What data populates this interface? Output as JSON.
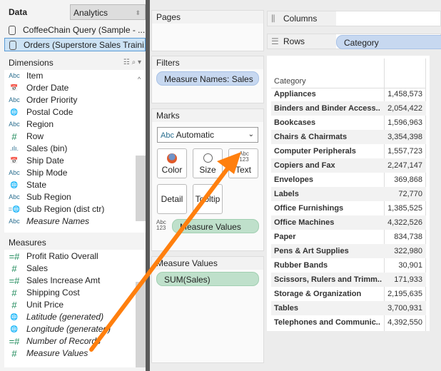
{
  "tabs": {
    "data": "Data",
    "analytics": "Analytics"
  },
  "datasources": [
    "CoffeeChain Query (Sample - ...",
    "Orders (Superstore Sales Traini..."
  ],
  "dimensions": {
    "title": "Dimensions",
    "items": [
      {
        "icon": "Abc",
        "label": "Item"
      },
      {
        "icon": "📅",
        "label": "Order Date"
      },
      {
        "icon": "Abc",
        "label": "Order Priority"
      },
      {
        "icon": "🌐",
        "label": "Postal Code"
      },
      {
        "icon": "Abc",
        "label": "Region"
      },
      {
        "icon": "#",
        "label": "Row"
      },
      {
        "icon": ".ılı.",
        "label": "Sales (bin)"
      },
      {
        "icon": "📅",
        "label": "Ship Date"
      },
      {
        "icon": "Abc",
        "label": "Ship Mode"
      },
      {
        "icon": "🌐",
        "label": "State"
      },
      {
        "icon": "Abc",
        "label": "Sub Region"
      },
      {
        "icon": "=🌐",
        "label": "Sub Region (dist ctr)"
      },
      {
        "icon": "Abc",
        "label": "Measure Names"
      }
    ]
  },
  "measures": {
    "title": "Measures",
    "items": [
      {
        "icon": "=#",
        "label": "Profit Ratio Overall"
      },
      {
        "icon": "#",
        "label": "Sales"
      },
      {
        "icon": "=#",
        "label": "Sales Increase Amt"
      },
      {
        "icon": "#",
        "label": "Shipping Cost"
      },
      {
        "icon": "#",
        "label": "Unit Price"
      },
      {
        "icon": "🌐",
        "label": "Latitude (generated)"
      },
      {
        "icon": "🌐",
        "label": "Longitude (generated)"
      },
      {
        "icon": "=#",
        "label": "Number of Records"
      },
      {
        "icon": "#",
        "label": "Measure Values"
      }
    ]
  },
  "pages": {
    "title": "Pages"
  },
  "filters": {
    "title": "Filters",
    "pill": "Measure Names: Sales"
  },
  "marks": {
    "title": "Marks",
    "type_icon": "Abc",
    "type": "Automatic",
    "color": "Color",
    "size": "Size",
    "text": "Text",
    "text_icon": "Abc 123",
    "detail": "Detail",
    "tooltip": "Tooltip",
    "pill_icon": "Abc 123",
    "pill": "Measure Values"
  },
  "measure_values": {
    "title": "Measure Values",
    "pill": "SUM(Sales)"
  },
  "columns": {
    "label": "Columns"
  },
  "rows": {
    "label": "Rows",
    "pill": "Category"
  },
  "table": {
    "header": "Category",
    "rows": [
      [
        "Appliances",
        "1,458,573"
      ],
      [
        "Binders and Binder Access..",
        "2,054,422"
      ],
      [
        "Bookcases",
        "1,596,963"
      ],
      [
        "Chairs & Chairmats",
        "3,354,398"
      ],
      [
        "Computer Peripherals",
        "1,557,723"
      ],
      [
        "Copiers and Fax",
        "2,247,147"
      ],
      [
        "Envelopes",
        "369,868"
      ],
      [
        "Labels",
        "72,770"
      ],
      [
        "Office Furnishings",
        "1,385,525"
      ],
      [
        "Office Machines",
        "4,322,526"
      ],
      [
        "Paper",
        "834,738"
      ],
      [
        "Pens & Art Supplies",
        "322,980"
      ],
      [
        "Rubber Bands",
        "30,901"
      ],
      [
        "Scissors, Rulers and Trimm..",
        "171,933"
      ],
      [
        "Storage & Organization",
        "2,195,635"
      ],
      [
        "Tables",
        "3,700,931"
      ],
      [
        "Telephones and Communic..",
        "4,392,550"
      ]
    ]
  },
  "colors": {
    "arrow": "#ff7f0e"
  }
}
